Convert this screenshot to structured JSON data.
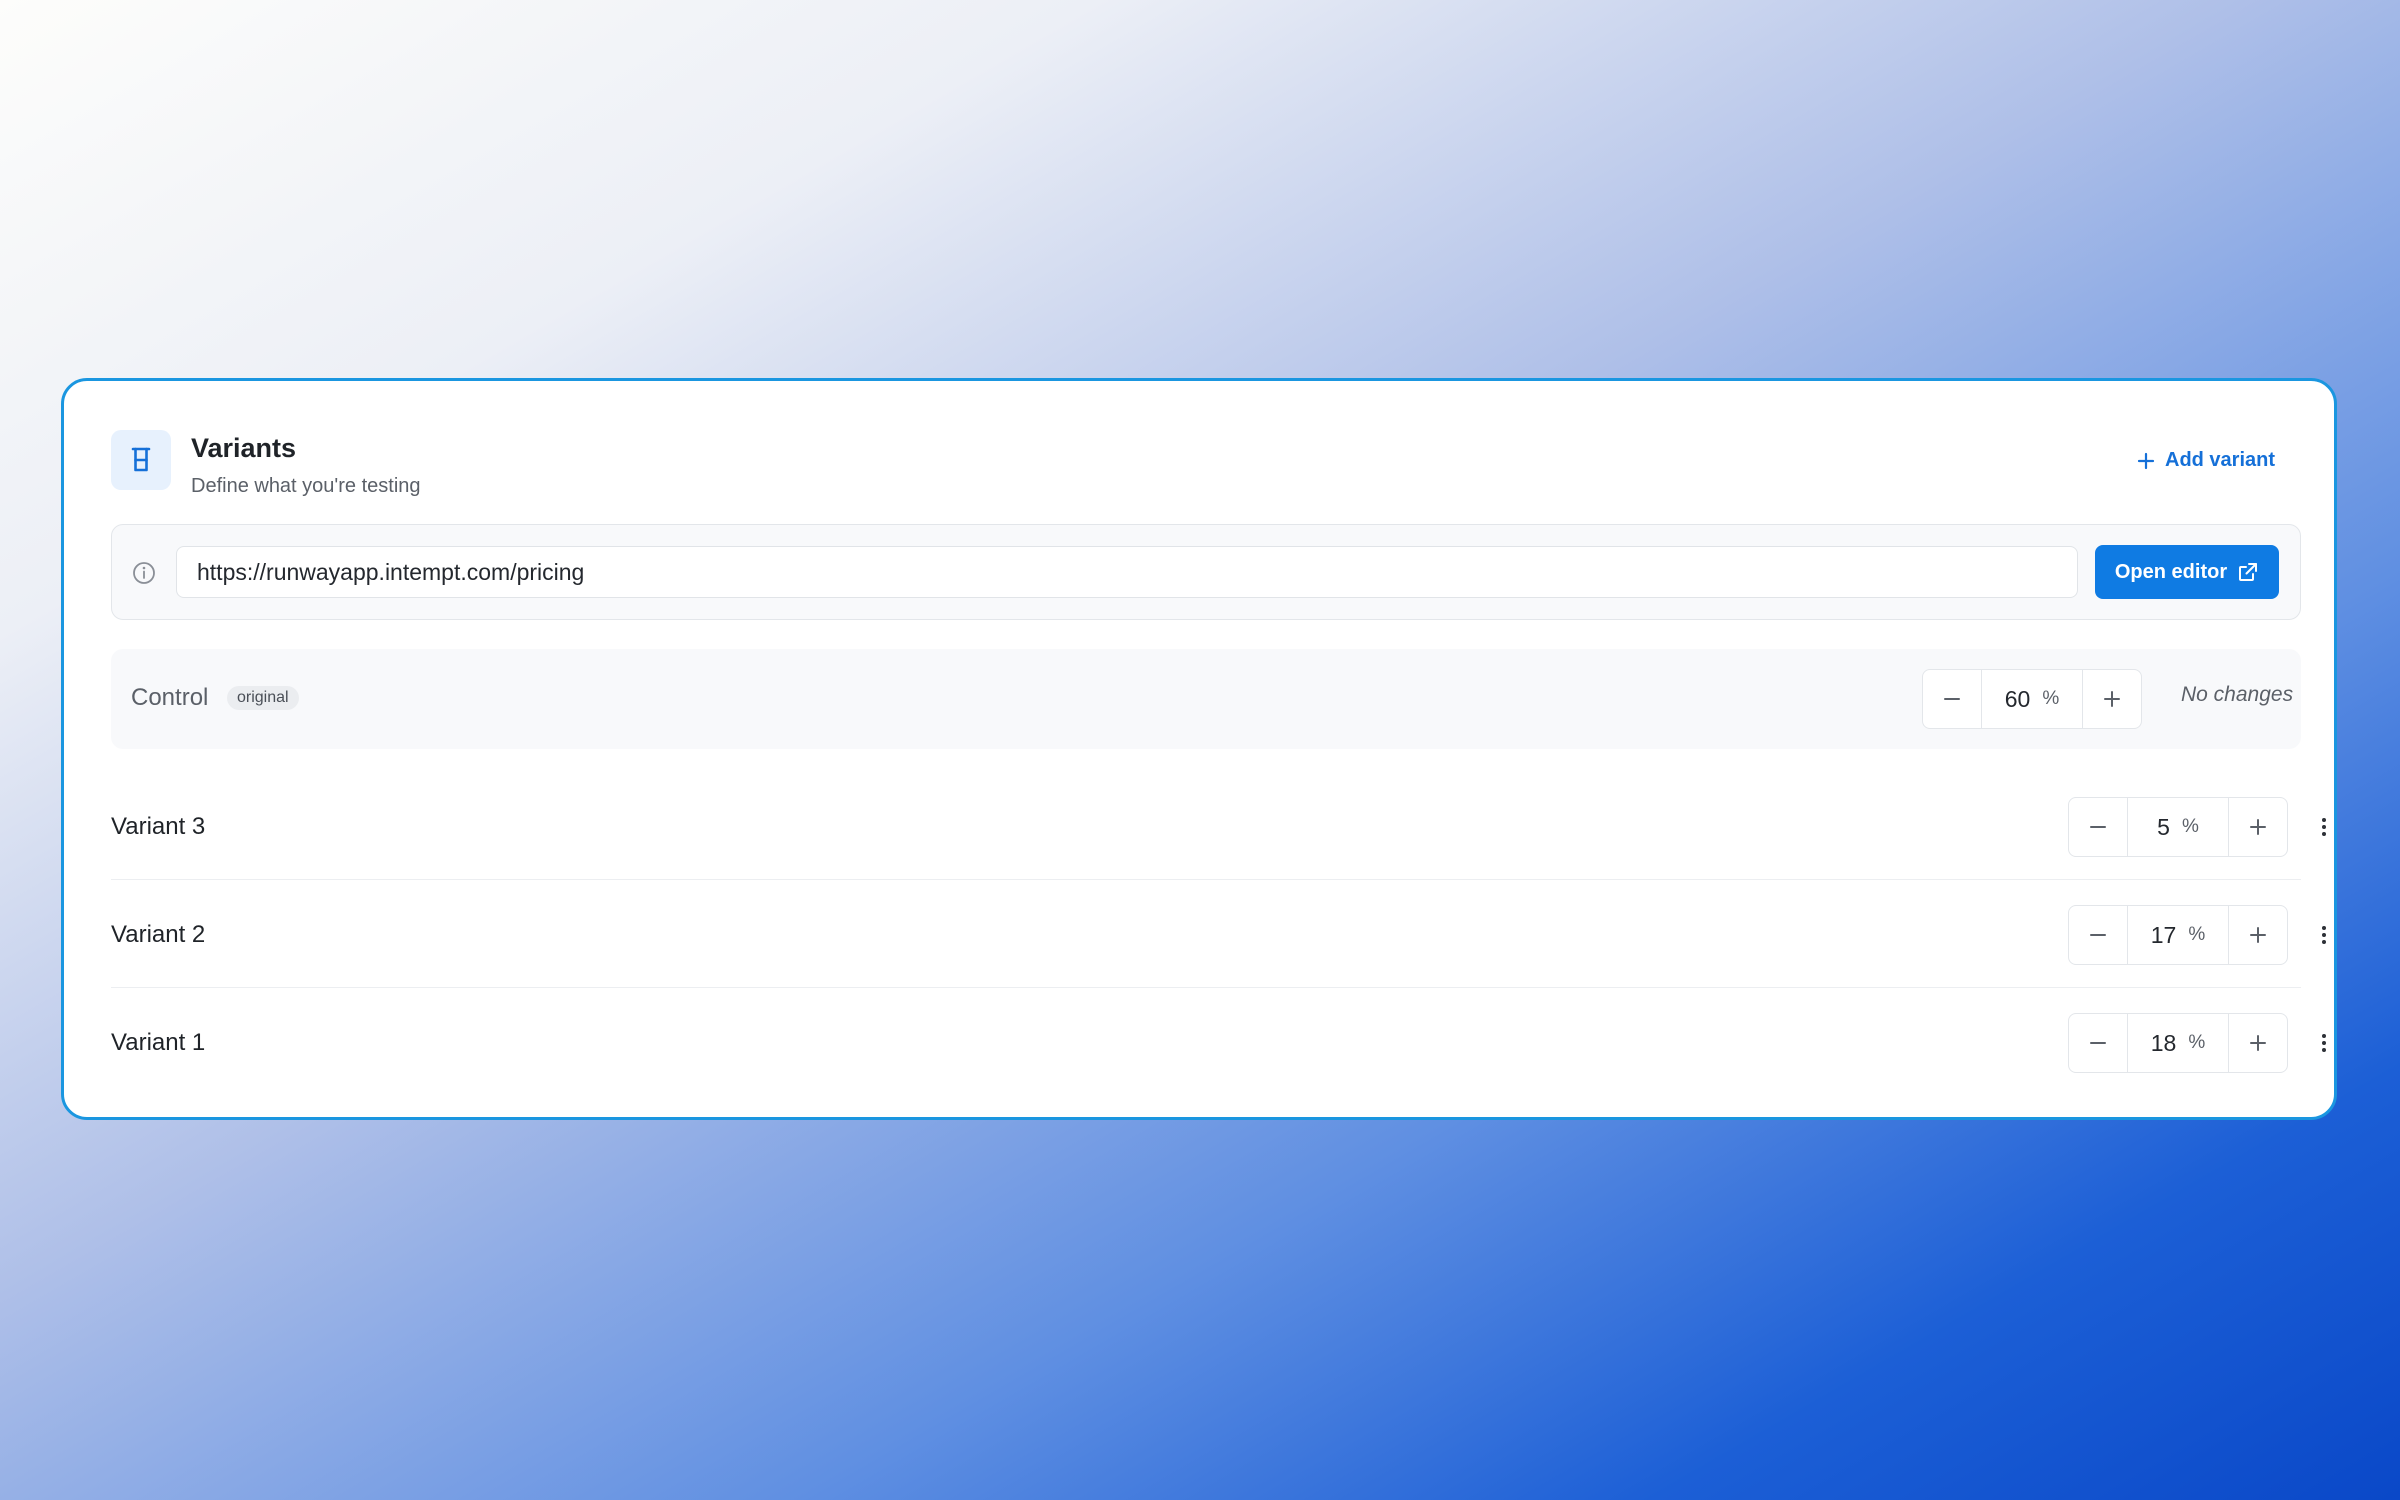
{
  "header": {
    "icon": "beaker-icon",
    "title": "Variants",
    "subtitle": "Define what you're testing",
    "add_variant_label": "Add variant"
  },
  "url_bar": {
    "value": "https://runwayapp.intempt.com/pricing",
    "open_editor_label": "Open editor"
  },
  "control": {
    "label": "Control",
    "badge": "original",
    "value": "60",
    "unit": "%",
    "status": "No changes"
  },
  "variants": [
    {
      "name": "Variant 3",
      "value": "5",
      "unit": "%"
    },
    {
      "name": "Variant 2",
      "value": "17",
      "unit": "%"
    },
    {
      "name": "Variant 1",
      "value": "18",
      "unit": "%"
    }
  ],
  "colors": {
    "accent": "#0f7be3",
    "card_border": "#1a96e0",
    "text": "#1f2328",
    "muted": "#5b6068"
  }
}
